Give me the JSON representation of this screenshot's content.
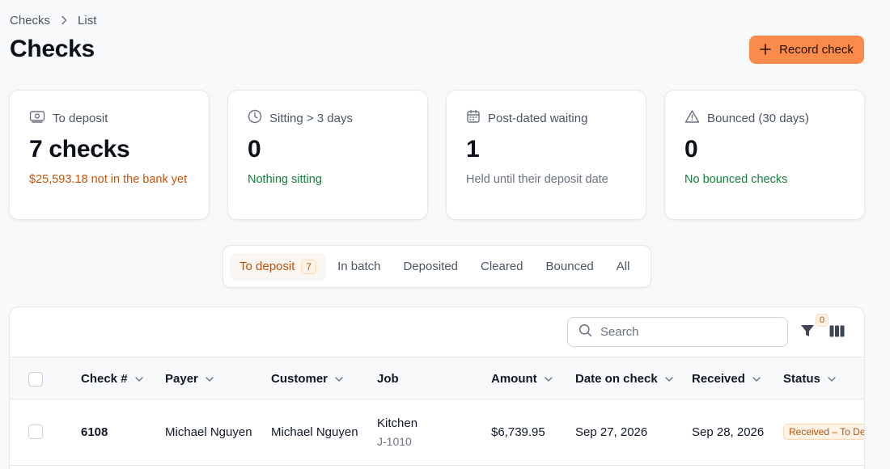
{
  "breadcrumb": {
    "root": "Checks",
    "current": "List"
  },
  "page": {
    "title": "Checks",
    "record_button": "Record check"
  },
  "stats": [
    {
      "label": "To deposit",
      "value": "7 checks",
      "sub": "$25,593.18 not in the bank yet",
      "icon": "banknote-icon"
    },
    {
      "label": "Sitting > 3 days",
      "value": "0",
      "sub": "Nothing sitting",
      "icon": "clock-icon"
    },
    {
      "label": "Post-dated waiting",
      "value": "1",
      "sub": "Held until their deposit date",
      "icon": "calendar-icon"
    },
    {
      "label": "Bounced (30 days)",
      "value": "0",
      "sub": "No bounced checks",
      "icon": "warning-triangle-icon"
    }
  ],
  "tabs": [
    {
      "label": "To deposit",
      "count": "7",
      "active": true
    },
    {
      "label": "In batch"
    },
    {
      "label": "Deposited"
    },
    {
      "label": "Cleared"
    },
    {
      "label": "Bounced"
    },
    {
      "label": "All"
    }
  ],
  "toolbar": {
    "search_placeholder": "Search",
    "filter_count": "0"
  },
  "table": {
    "columns": [
      "Check #",
      "Payer",
      "Customer",
      "Job",
      "Amount",
      "Date on check",
      "Received",
      "Status"
    ],
    "rows": [
      {
        "check_no": "6108",
        "payer": "Michael Nguyen",
        "customer": "Michael Nguyen",
        "job": "Kitchen",
        "job_code": "J-1010",
        "amount": "$6,739.95",
        "date_on_check": "Sep 27, 2026",
        "received": "Sep 28, 2026",
        "status": "Received – To Deposit"
      }
    ]
  },
  "colors": {
    "accent": "#fb8b4b",
    "warning": "#c2550f",
    "success": "#15803d"
  }
}
